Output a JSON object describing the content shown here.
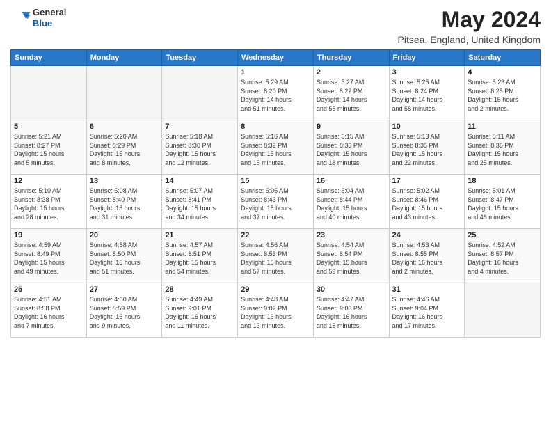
{
  "header": {
    "logo_general": "General",
    "logo_blue": "Blue",
    "month_year": "May 2024",
    "location": "Pitsea, England, United Kingdom"
  },
  "weekdays": [
    "Sunday",
    "Monday",
    "Tuesday",
    "Wednesday",
    "Thursday",
    "Friday",
    "Saturday"
  ],
  "weeks": [
    [
      {
        "day": "",
        "info": ""
      },
      {
        "day": "",
        "info": ""
      },
      {
        "day": "",
        "info": ""
      },
      {
        "day": "1",
        "info": "Sunrise: 5:29 AM\nSunset: 8:20 PM\nDaylight: 14 hours\nand 51 minutes."
      },
      {
        "day": "2",
        "info": "Sunrise: 5:27 AM\nSunset: 8:22 PM\nDaylight: 14 hours\nand 55 minutes."
      },
      {
        "day": "3",
        "info": "Sunrise: 5:25 AM\nSunset: 8:24 PM\nDaylight: 14 hours\nand 58 minutes."
      },
      {
        "day": "4",
        "info": "Sunrise: 5:23 AM\nSunset: 8:25 PM\nDaylight: 15 hours\nand 2 minutes."
      }
    ],
    [
      {
        "day": "5",
        "info": "Sunrise: 5:21 AM\nSunset: 8:27 PM\nDaylight: 15 hours\nand 5 minutes."
      },
      {
        "day": "6",
        "info": "Sunrise: 5:20 AM\nSunset: 8:29 PM\nDaylight: 15 hours\nand 8 minutes."
      },
      {
        "day": "7",
        "info": "Sunrise: 5:18 AM\nSunset: 8:30 PM\nDaylight: 15 hours\nand 12 minutes."
      },
      {
        "day": "8",
        "info": "Sunrise: 5:16 AM\nSunset: 8:32 PM\nDaylight: 15 hours\nand 15 minutes."
      },
      {
        "day": "9",
        "info": "Sunrise: 5:15 AM\nSunset: 8:33 PM\nDaylight: 15 hours\nand 18 minutes."
      },
      {
        "day": "10",
        "info": "Sunrise: 5:13 AM\nSunset: 8:35 PM\nDaylight: 15 hours\nand 22 minutes."
      },
      {
        "day": "11",
        "info": "Sunrise: 5:11 AM\nSunset: 8:36 PM\nDaylight: 15 hours\nand 25 minutes."
      }
    ],
    [
      {
        "day": "12",
        "info": "Sunrise: 5:10 AM\nSunset: 8:38 PM\nDaylight: 15 hours\nand 28 minutes."
      },
      {
        "day": "13",
        "info": "Sunrise: 5:08 AM\nSunset: 8:40 PM\nDaylight: 15 hours\nand 31 minutes."
      },
      {
        "day": "14",
        "info": "Sunrise: 5:07 AM\nSunset: 8:41 PM\nDaylight: 15 hours\nand 34 minutes."
      },
      {
        "day": "15",
        "info": "Sunrise: 5:05 AM\nSunset: 8:43 PM\nDaylight: 15 hours\nand 37 minutes."
      },
      {
        "day": "16",
        "info": "Sunrise: 5:04 AM\nSunset: 8:44 PM\nDaylight: 15 hours\nand 40 minutes."
      },
      {
        "day": "17",
        "info": "Sunrise: 5:02 AM\nSunset: 8:46 PM\nDaylight: 15 hours\nand 43 minutes."
      },
      {
        "day": "18",
        "info": "Sunrise: 5:01 AM\nSunset: 8:47 PM\nDaylight: 15 hours\nand 46 minutes."
      }
    ],
    [
      {
        "day": "19",
        "info": "Sunrise: 4:59 AM\nSunset: 8:49 PM\nDaylight: 15 hours\nand 49 minutes."
      },
      {
        "day": "20",
        "info": "Sunrise: 4:58 AM\nSunset: 8:50 PM\nDaylight: 15 hours\nand 51 minutes."
      },
      {
        "day": "21",
        "info": "Sunrise: 4:57 AM\nSunset: 8:51 PM\nDaylight: 15 hours\nand 54 minutes."
      },
      {
        "day": "22",
        "info": "Sunrise: 4:56 AM\nSunset: 8:53 PM\nDaylight: 15 hours\nand 57 minutes."
      },
      {
        "day": "23",
        "info": "Sunrise: 4:54 AM\nSunset: 8:54 PM\nDaylight: 15 hours\nand 59 minutes."
      },
      {
        "day": "24",
        "info": "Sunrise: 4:53 AM\nSunset: 8:55 PM\nDaylight: 16 hours\nand 2 minutes."
      },
      {
        "day": "25",
        "info": "Sunrise: 4:52 AM\nSunset: 8:57 PM\nDaylight: 16 hours\nand 4 minutes."
      }
    ],
    [
      {
        "day": "26",
        "info": "Sunrise: 4:51 AM\nSunset: 8:58 PM\nDaylight: 16 hours\nand 7 minutes."
      },
      {
        "day": "27",
        "info": "Sunrise: 4:50 AM\nSunset: 8:59 PM\nDaylight: 16 hours\nand 9 minutes."
      },
      {
        "day": "28",
        "info": "Sunrise: 4:49 AM\nSunset: 9:01 PM\nDaylight: 16 hours\nand 11 minutes."
      },
      {
        "day": "29",
        "info": "Sunrise: 4:48 AM\nSunset: 9:02 PM\nDaylight: 16 hours\nand 13 minutes."
      },
      {
        "day": "30",
        "info": "Sunrise: 4:47 AM\nSunset: 9:03 PM\nDaylight: 16 hours\nand 15 minutes."
      },
      {
        "day": "31",
        "info": "Sunrise: 4:46 AM\nSunset: 9:04 PM\nDaylight: 16 hours\nand 17 minutes."
      },
      {
        "day": "",
        "info": ""
      }
    ]
  ]
}
